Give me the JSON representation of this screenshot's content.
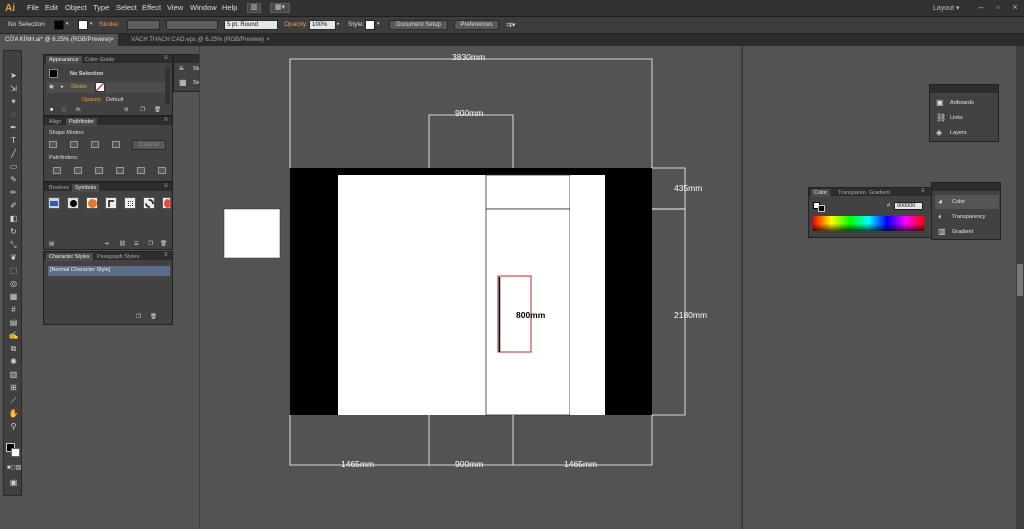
{
  "menubar": {
    "app_logo": "Ai",
    "items": [
      "File",
      "Edit",
      "Object",
      "Type",
      "Select",
      "Effect",
      "View",
      "Window",
      "Help"
    ],
    "workspace": "Layout ▾"
  },
  "controlbar": {
    "selection": "No Selection",
    "stroke_label": "Stroke:",
    "brush": "5 pt. Round",
    "opacity_label": "Opacity:",
    "opacity_value": "100%",
    "style_label": "Style:",
    "document_setup": "Document Setup",
    "preferences": "Preferences"
  },
  "tabs": [
    {
      "label": "CỬA KÍNH.ai* @ 6.25% (RGB/Preview)",
      "close": "×"
    },
    {
      "label": "VÁCH THẠCH CAO.eps @ 6.25% (RGB/Preview)",
      "close": "×"
    }
  ],
  "appearance_panel": {
    "tabs": [
      "Appearance",
      "Color Guide"
    ],
    "selection": "No Selection",
    "stroke_label": "Stroke",
    "opacity_label": "Opacity:",
    "opacity_value": "Default",
    "fx": "fx."
  },
  "pathfinder_panel": {
    "tabs": [
      "Align",
      "Pathfinder"
    ],
    "shape_modes": "Shape Modes:",
    "expand": "Expand",
    "pathfinders": "Pathfinders:"
  },
  "symbols_panel": {
    "tabs": [
      "Brushes",
      "Symbols"
    ]
  },
  "character_styles_panel": {
    "tabs": [
      "Character Styles",
      "Paragraph Styles"
    ],
    "item": "[Normal Character Style]"
  },
  "stroke_swatches_panel": {
    "items": [
      "Stroke",
      "Swatches"
    ]
  },
  "artboards_panel": {
    "items": [
      "Artboards",
      "Links",
      "Layers"
    ]
  },
  "color_panel": {
    "tabs": [
      "Color",
      "Transparen",
      "Gradient"
    ],
    "hash": "#",
    "hex": "000000"
  },
  "color_stack": {
    "items": [
      "Color",
      "Transparency",
      "Gradient"
    ]
  },
  "canvas": {
    "dimensions": {
      "top_total": "3830mm",
      "top_opening": "900mm",
      "right_top": "435mm",
      "right_height": "2180mm",
      "center": "800mm",
      "bottom_left": "1465mm",
      "bottom_center": "900mm",
      "bottom_right": "1465mm"
    }
  },
  "colors": {
    "ui_dark": "#323232",
    "panel": "#424242",
    "canvas_bg": "#535353",
    "accent_orange": "#e8a13a",
    "handle_red": "#d02020"
  }
}
